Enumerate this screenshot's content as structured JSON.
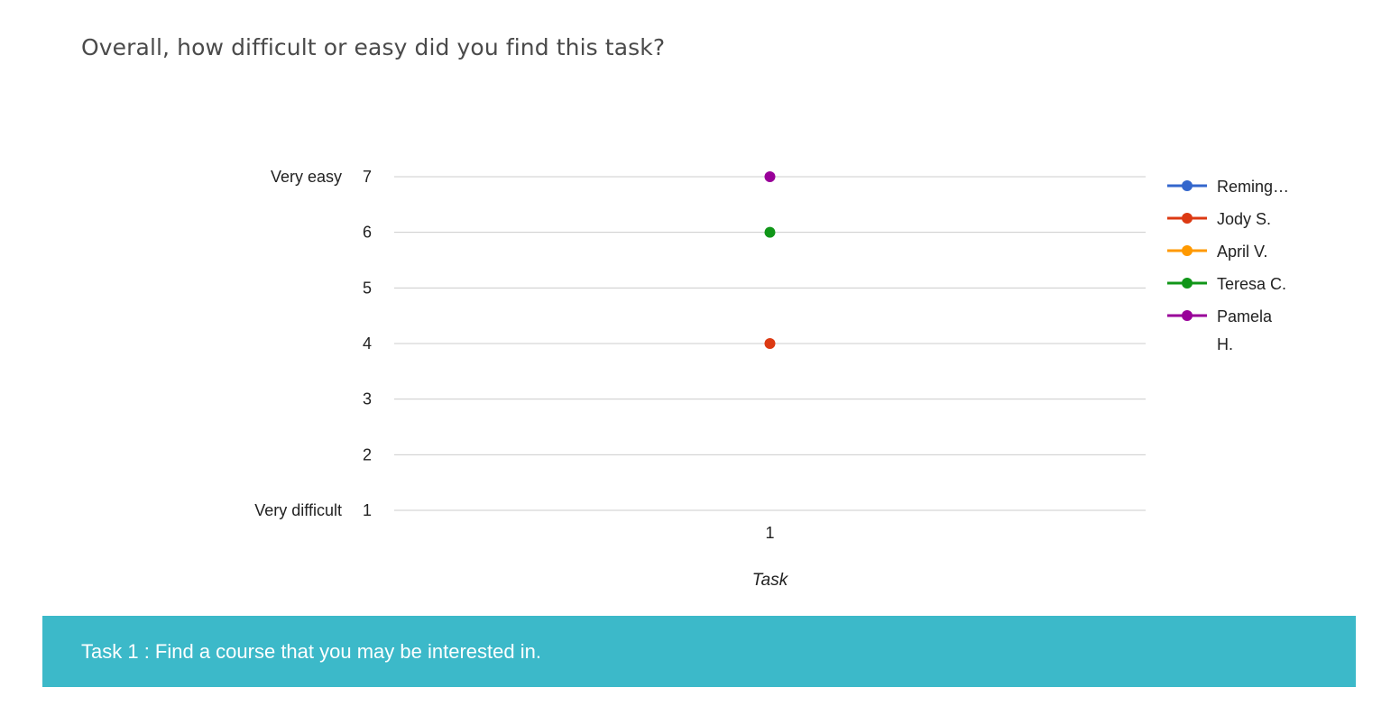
{
  "question": {
    "text": "Overall, how difficult or easy did you find this task?"
  },
  "chart_data": {
    "type": "scatter",
    "xlabel": "Task",
    "ylabel": "",
    "categories": [
      "1"
    ],
    "ylim": [
      1,
      7
    ],
    "yticks": [
      {
        "value": 7,
        "label": "7",
        "text": "Very easy"
      },
      {
        "value": 6,
        "label": "6",
        "text": ""
      },
      {
        "value": 5,
        "label": "5",
        "text": ""
      },
      {
        "value": 4,
        "label": "4",
        "text": ""
      },
      {
        "value": 3,
        "label": "3",
        "text": ""
      },
      {
        "value": 2,
        "label": "2",
        "text": ""
      },
      {
        "value": 1,
        "label": "1",
        "text": "Very difficult"
      }
    ],
    "grid": true,
    "legend_position": "right",
    "series": [
      {
        "name": "Reming…",
        "color": "#3366cc",
        "values": [
          null
        ]
      },
      {
        "name": "Jody S.",
        "color": "#dc3912",
        "values": [
          4
        ]
      },
      {
        "name": "April V.",
        "color": "#ff9900",
        "values": [
          null
        ]
      },
      {
        "name": "Teresa C.",
        "color": "#109618",
        "values": [
          6
        ]
      },
      {
        "name": "Pamela H.",
        "name_lines": [
          "Pamela",
          "H."
        ],
        "color": "#990099",
        "values": [
          7
        ]
      }
    ]
  },
  "task_bar": {
    "label": "Task 1 : Find a course that you may be interested in."
  }
}
